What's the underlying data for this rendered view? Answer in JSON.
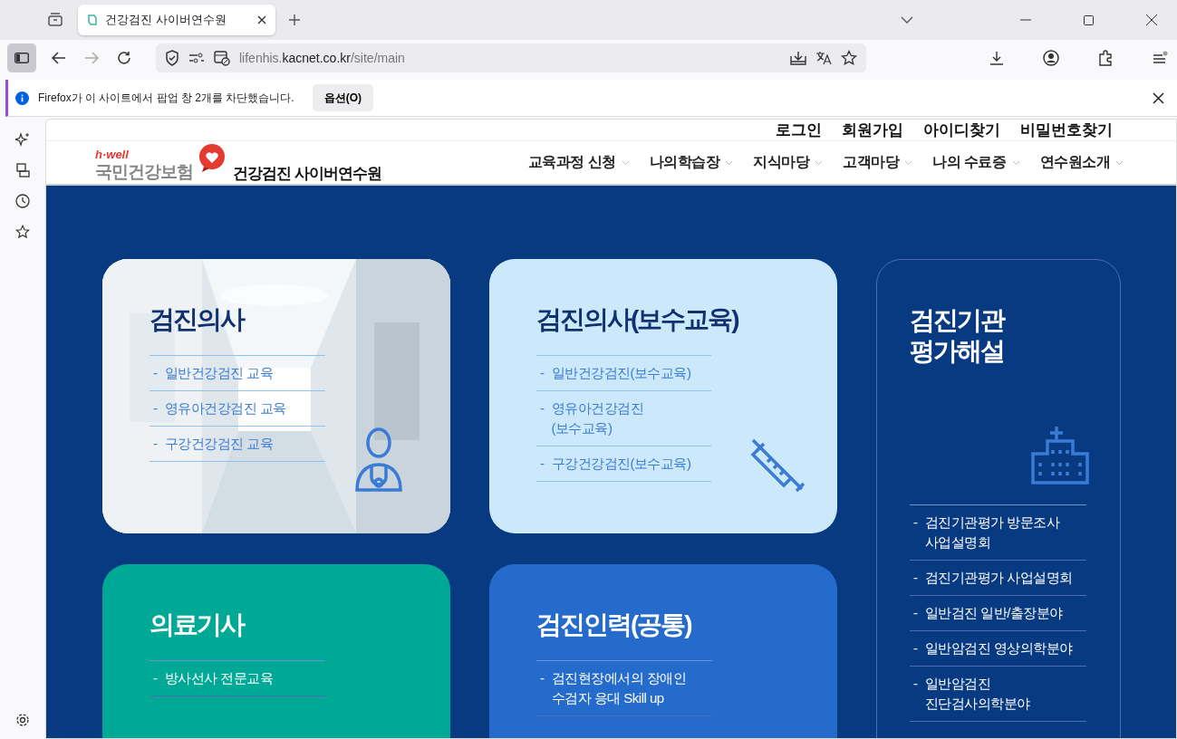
{
  "browser": {
    "tabs": [
      {
        "title": "건강검진 사이버연수원",
        "selected": true
      }
    ],
    "url": {
      "prefix": "lifenhis.",
      "domain": "kacnet.co.kr",
      "path": "/site/main"
    },
    "notification": {
      "text": "Firefox가 이 사이트에서 팝업 창 2개를 차단했습니다.",
      "button": "옵션(O)"
    }
  },
  "site": {
    "top_links": [
      "로그인",
      "회원가입",
      "아이디찾기",
      "비밀번호찾기"
    ],
    "logo": {
      "tagline": "h·well",
      "brand": "국민건강보험",
      "title": "건강검진 사이버연수원"
    },
    "nav": [
      "교육과정 신청",
      "나의학습장",
      "지식마당",
      "고객마당",
      "나의 수료증",
      "연수원소개"
    ],
    "cards": [
      {
        "title": "검진의사",
        "items": [
          {
            "dash": "-",
            "text": "일반건강검진 교육"
          },
          {
            "dash": "-",
            "text": "영유아건강검진 교육"
          },
          {
            "dash": "-",
            "text": "구강건강검진 교육"
          }
        ]
      },
      {
        "kind": "light",
        "title": "검진의사(보수교육)",
        "items": [
          {
            "dash": "-",
            "text": "일반건강검진(보수교육)"
          },
          {
            "dash": "-",
            "text": "영유아건강검진\n(보수교육)"
          },
          {
            "dash": "-",
            "text": "구강건강검진(보수교육)"
          }
        ]
      },
      {
        "kind": "outline",
        "title": "검진기관\n평가해설",
        "items": [
          {
            "dash": "-",
            "text": "검진기관평가 방문조사\n사업설명회"
          },
          {
            "dash": "-",
            "text": "검진기관평가 사업설명회"
          },
          {
            "dash": "-",
            "text": "일반검진 일반/출장분야"
          },
          {
            "dash": "-",
            "text": "일반암검진 영상의학분야"
          },
          {
            "dash": "-",
            "text": "일반암검진\n진단검사의학분야"
          }
        ]
      },
      {
        "kind": "teal",
        "title": "의료기사",
        "items": [
          {
            "dash": "-",
            "text": "방사선사 전문교육"
          }
        ]
      },
      {
        "kind": "blue",
        "title": "검진인력(공통)",
        "items": [
          {
            "dash": "-",
            "text": "검진현장에서의 장애인\n수검자 응대 Skill up"
          }
        ]
      }
    ]
  }
}
